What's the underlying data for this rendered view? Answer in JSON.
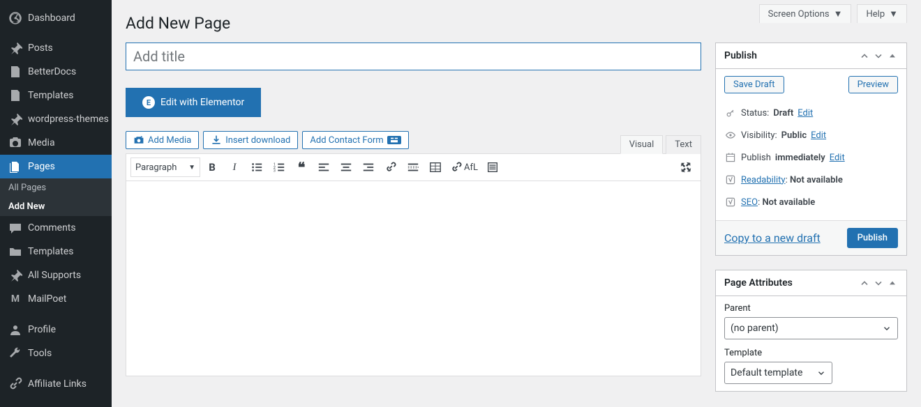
{
  "topbar": {
    "screen_options": "Screen Options",
    "help": "Help"
  },
  "sidebar": {
    "items": [
      {
        "label": "Dashboard"
      },
      {
        "label": "Posts"
      },
      {
        "label": "BetterDocs"
      },
      {
        "label": "Templates"
      },
      {
        "label": "wordpress-themes"
      },
      {
        "label": "Media"
      },
      {
        "label": "Pages"
      },
      {
        "label": "Comments"
      },
      {
        "label": "Templates"
      },
      {
        "label": "All Supports"
      },
      {
        "label": "MailPoet"
      },
      {
        "label": "Profile"
      },
      {
        "label": "Tools"
      },
      {
        "label": "Affiliate Links"
      }
    ],
    "sub_all": "All Pages",
    "sub_add": "Add New"
  },
  "page": {
    "heading": "Add New Page",
    "title_placeholder": "Add title",
    "elementor": "Edit with Elementor"
  },
  "mediabar": {
    "add_media": "Add Media",
    "insert_dl": "Insert download",
    "contact_form": "Add Contact Form"
  },
  "editor": {
    "tab_visual": "Visual",
    "tab_text": "Text",
    "format": "Paragraph",
    "afl": "AfL"
  },
  "publish": {
    "title": "Publish",
    "save_draft": "Save Draft",
    "preview": "Preview",
    "status_label": "Status:",
    "status_value": "Draft",
    "visibility_label": "Visibility:",
    "visibility_value": "Public",
    "publish_label": "Publish",
    "publish_value": "immediately",
    "readability": "Readability",
    "seo": "SEO",
    "not_available": "Not available",
    "edit": "Edit",
    "copy": "Copy to a new draft",
    "publish_btn": "Publish"
  },
  "attrs": {
    "title": "Page Attributes",
    "parent_label": "Parent",
    "parent_value": "(no parent)",
    "template_label": "Template",
    "template_value": "Default template"
  }
}
